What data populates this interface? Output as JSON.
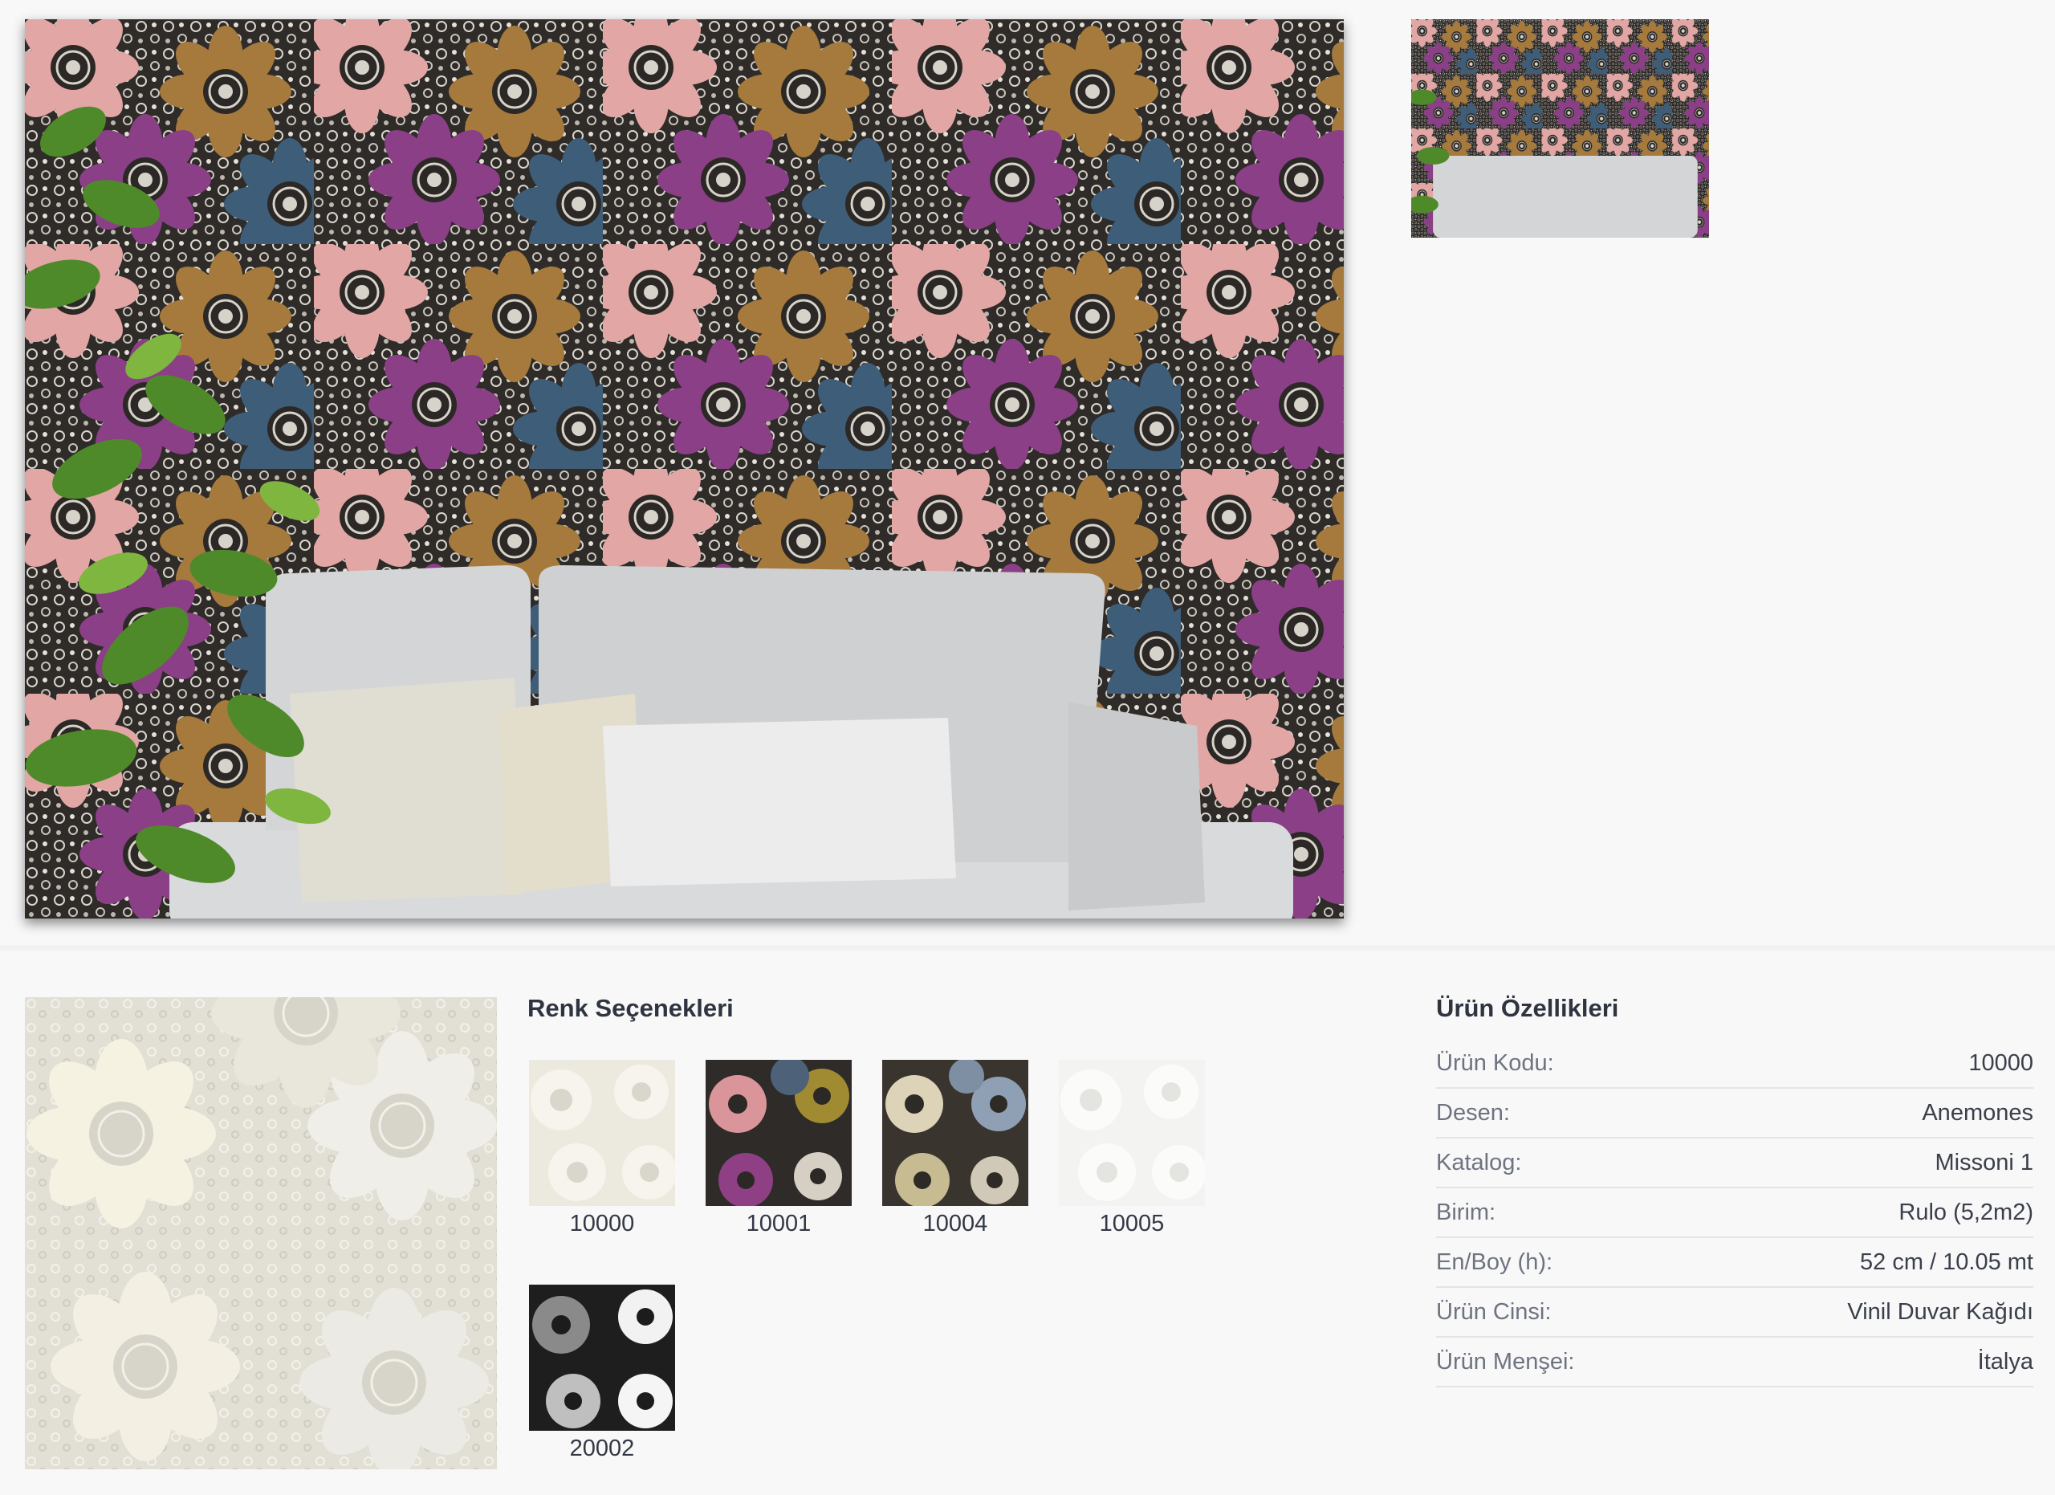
{
  "gallery": {
    "main_image": "wallpaper-room-photo",
    "thumbnails": [
      "wallpaper-room-thumb"
    ]
  },
  "color_options": {
    "title": "Renk Seçenekleri",
    "items": [
      {
        "code": "10000",
        "palette": [
          "#ece9df",
          "#f3f1ea",
          "#d9d6cb"
        ]
      },
      {
        "code": "10001",
        "palette": [
          "#d9959a",
          "#8f3f84",
          "#a08a32"
        ]
      },
      {
        "code": "10004",
        "palette": [
          "#d8cdb0",
          "#8fa0b4",
          "#3a342e"
        ]
      },
      {
        "code": "10005",
        "palette": [
          "#f6f6f5",
          "#eeeeec",
          "#e2e2df"
        ]
      },
      {
        "code": "20002",
        "palette": [
          "#f2f2f2",
          "#8a8a8a",
          "#1e1e1e"
        ]
      }
    ]
  },
  "product_features": {
    "title": "Ürün Özellikleri",
    "rows": [
      {
        "key": "Ürün Kodu:",
        "value": "10000"
      },
      {
        "key": "Desen:",
        "value": "Anemones"
      },
      {
        "key": "Katalog:",
        "value": "Missoni 1"
      },
      {
        "key": "Birim:",
        "value": "Rulo (5,2m2)"
      },
      {
        "key": "En/Boy (h):",
        "value": "52 cm / 10.05 mt"
      },
      {
        "key": "Ürün Cinsi:",
        "value": "Vinil Duvar Kağıdı"
      },
      {
        "key": "Ürün Menşei:",
        "value": "İtalya"
      }
    ]
  }
}
